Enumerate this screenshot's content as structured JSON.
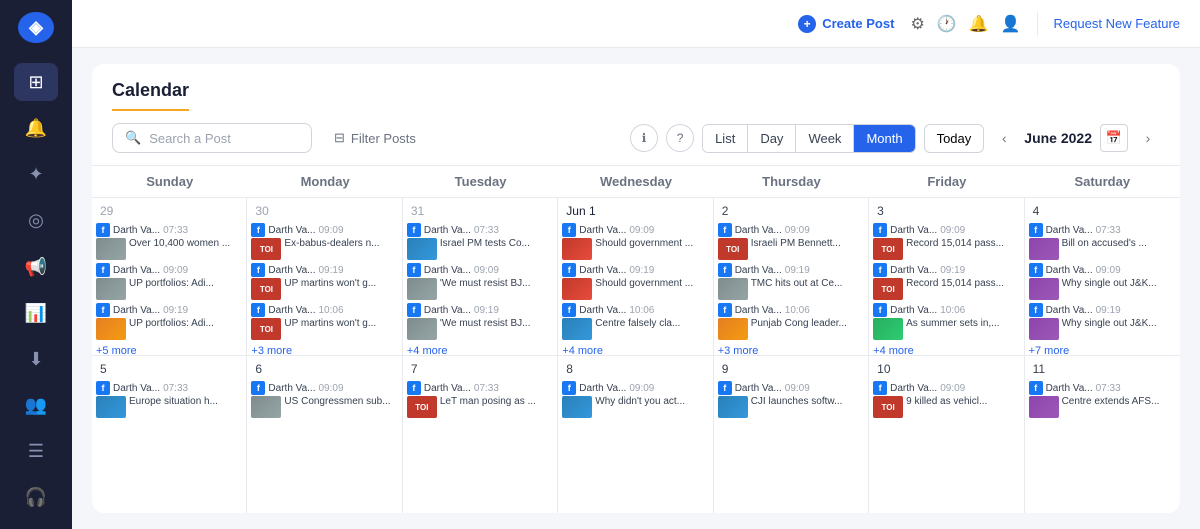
{
  "sidebar": {
    "logo": "◈",
    "items": [
      {
        "name": "dashboard",
        "icon": "⊞",
        "active": false
      },
      {
        "name": "notifications",
        "icon": "🔔",
        "active": false
      },
      {
        "name": "analytics",
        "icon": "✦",
        "active": false
      },
      {
        "name": "circle",
        "icon": "◎",
        "active": false
      },
      {
        "name": "megaphone",
        "icon": "📢",
        "active": false
      },
      {
        "name": "chart",
        "icon": "📊",
        "active": false
      },
      {
        "name": "download",
        "icon": "⬇",
        "active": false
      },
      {
        "name": "people",
        "icon": "👥",
        "active": false
      },
      {
        "name": "list",
        "icon": "☰",
        "active": false
      },
      {
        "name": "headset",
        "icon": "🎧",
        "active": false
      }
    ]
  },
  "topnav": {
    "create_post": "Create Post",
    "request_feature": "Request New Feature"
  },
  "calendar": {
    "title": "Calendar",
    "search_placeholder": "Search a Post",
    "filter_label": "Filter Posts",
    "today_label": "Today",
    "month_label": "June 2022",
    "view_options": [
      "List",
      "Day",
      "Week",
      "Month"
    ],
    "active_view": "Month"
  },
  "days": {
    "headers": [
      "Sunday",
      "Monday",
      "Tuesday",
      "Wednesday",
      "Thursday",
      "Friday",
      "Saturday"
    ]
  },
  "colors": {
    "accent": "#2563eb",
    "border": "#e8eaf0",
    "moreLink": "#2563eb"
  }
}
